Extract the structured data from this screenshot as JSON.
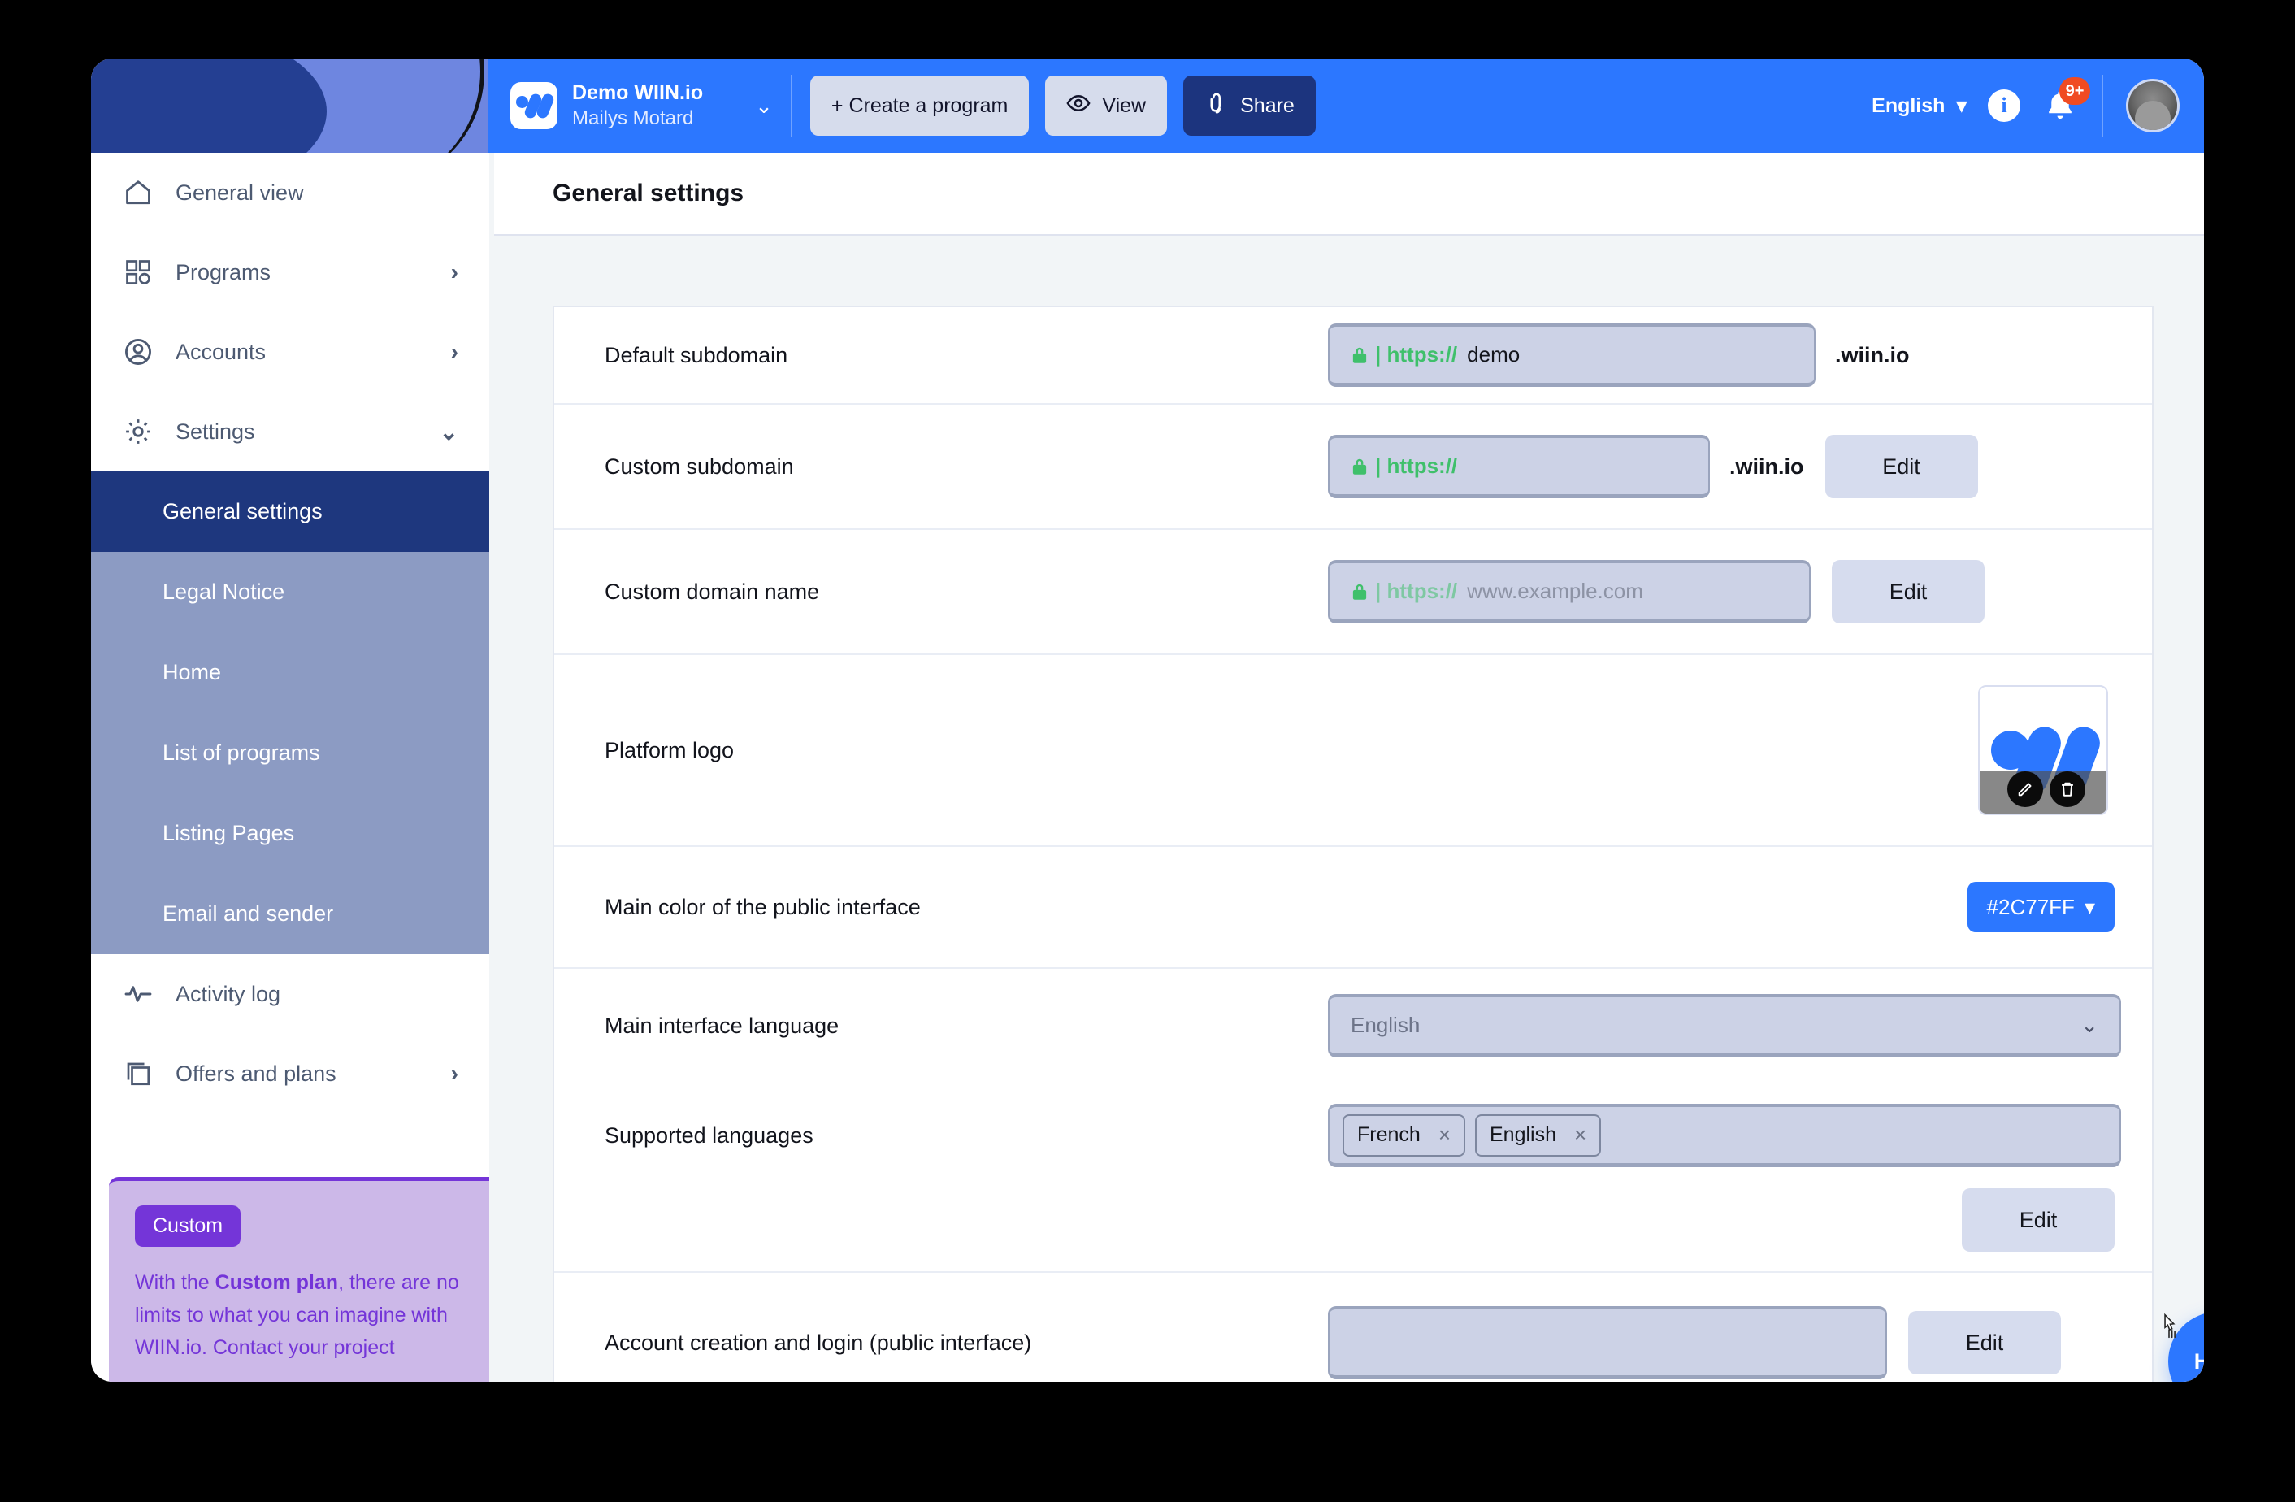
{
  "topbar": {
    "brand_title": "Demo WIIN.io",
    "brand_subtitle": "Mailys Motard",
    "brand_caret": "⌄",
    "create_program_label": "+ Create a program",
    "view_label": "View",
    "share_label": "Share",
    "language_label": "English",
    "language_caret": "▾",
    "info_label": "i",
    "notification_badge": "9+",
    "accent_color": "#2C77FF",
    "share_color": "#1c347e"
  },
  "sidebar": {
    "items": [
      {
        "label": "General view",
        "icon": "home-icon",
        "chevron": ""
      },
      {
        "label": "Programs",
        "icon": "grid-icon",
        "chevron": "›"
      },
      {
        "label": "Accounts",
        "icon": "user-circle-icon",
        "chevron": "›"
      },
      {
        "label": "Settings",
        "icon": "gear-icon",
        "chevron": "⌄"
      }
    ],
    "sub_items": [
      {
        "label": "General settings",
        "active": true
      },
      {
        "label": "Legal Notice",
        "active": false
      },
      {
        "label": "Home",
        "active": false
      },
      {
        "label": "List of programs",
        "active": false
      },
      {
        "label": "Listing Pages",
        "active": false
      },
      {
        "label": "Email and sender",
        "active": false
      }
    ],
    "footer_items": [
      {
        "label": "Activity log",
        "icon": "activity-icon",
        "chevron": ""
      },
      {
        "label": "Offers and plans",
        "icon": "layers-icon",
        "chevron": "›"
      }
    ],
    "plan": {
      "badge": "Custom",
      "text_before": "With the ",
      "text_bold": "Custom plan",
      "text_after": ", there are no limits to what you can imagine with WIIN.io. Contact your project",
      "accent_color": "#7435d8"
    }
  },
  "page": {
    "title": "General settings"
  },
  "settings": {
    "default_subdomain": {
      "label": "Default subdomain",
      "lock": "🔒",
      "protocol": "| https://",
      "value": "demo",
      "suffix": ".wiin.io"
    },
    "custom_subdomain": {
      "label": "Custom subdomain",
      "lock": "🔒",
      "protocol": "| https://",
      "value": "",
      "suffix": ".wiin.io",
      "edit_label": "Edit"
    },
    "custom_domain": {
      "label": "Custom domain name",
      "lock": "🔒",
      "protocol": "| https://",
      "placeholder": "www.example.com",
      "edit_label": "Edit"
    },
    "platform_logo": {
      "label": "Platform logo",
      "edit_icon": "pencil-icon",
      "delete_icon": "trash-icon"
    },
    "main_color": {
      "label": "Main color of the public interface",
      "value": "#2C77FF",
      "caret": "▾"
    },
    "main_language": {
      "label": "Main interface language",
      "value": "English",
      "caret": "⌄"
    },
    "supported_languages": {
      "label": "Supported languages",
      "chips": [
        "French",
        "English"
      ],
      "chip_remove": "×",
      "edit_label": "Edit"
    },
    "account_creation": {
      "label": "Account creation and login (public interface)",
      "value": "",
      "edit_label": "Edit"
    }
  },
  "help": {
    "label": "Help"
  }
}
